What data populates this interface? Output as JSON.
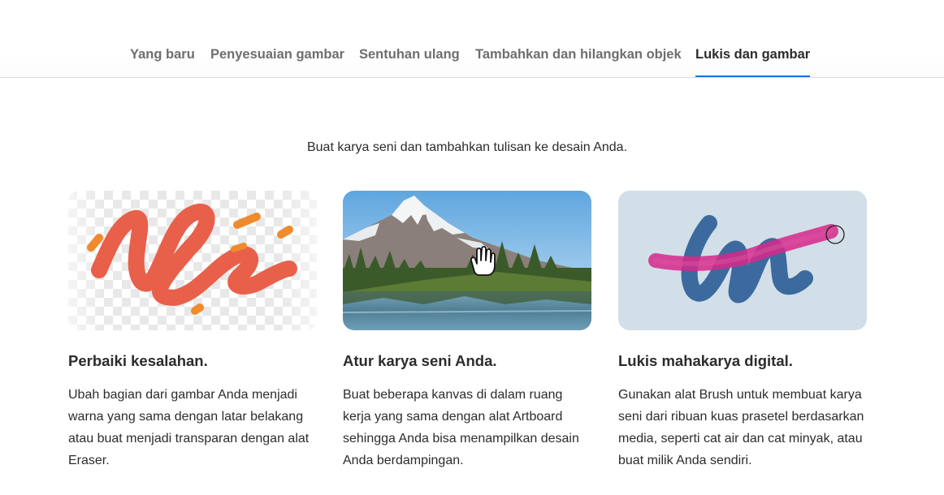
{
  "tabs": [
    {
      "label": "Yang baru",
      "active": false
    },
    {
      "label": "Penyesuaian gambar",
      "active": false
    },
    {
      "label": "Sentuhan ulang",
      "active": false
    },
    {
      "label": "Tambahkan dan hilangkan objek",
      "active": false
    },
    {
      "label": "Lukis dan gambar",
      "active": true
    }
  ],
  "accent_color": "#1473e6",
  "subtitle": "Buat karya seni dan tambahkan tulisan ke desain Anda.",
  "cards": [
    {
      "title": "Perbaiki kesalahan.",
      "description": "Ubah bagian dari gambar Anda menjadi warna yang sama dengan latar belakang atau buat menjadi transparan dengan alat Eraser.",
      "image": "eraser-strokes-transparent-checkerboard"
    },
    {
      "title": "Atur karya seni Anda.",
      "description": "Buat beberapa kanvas di dalam ruang kerja yang sama dengan alat Artboard sehingga Anda bisa menampilkan desain Anda berdampingan.",
      "image": "mountain-lake-landscape-with-hand-cursor"
    },
    {
      "title": "Lukis mahakarya digital.",
      "description": "Gunakan alat Brush untuk membuat karya seni dari ribuan kuas prasetel berdasarkan media, seperti cat air dan cat minyak, atau buat milik Anda sendiri.",
      "image": "brush-strokes-blue-pink"
    }
  ]
}
